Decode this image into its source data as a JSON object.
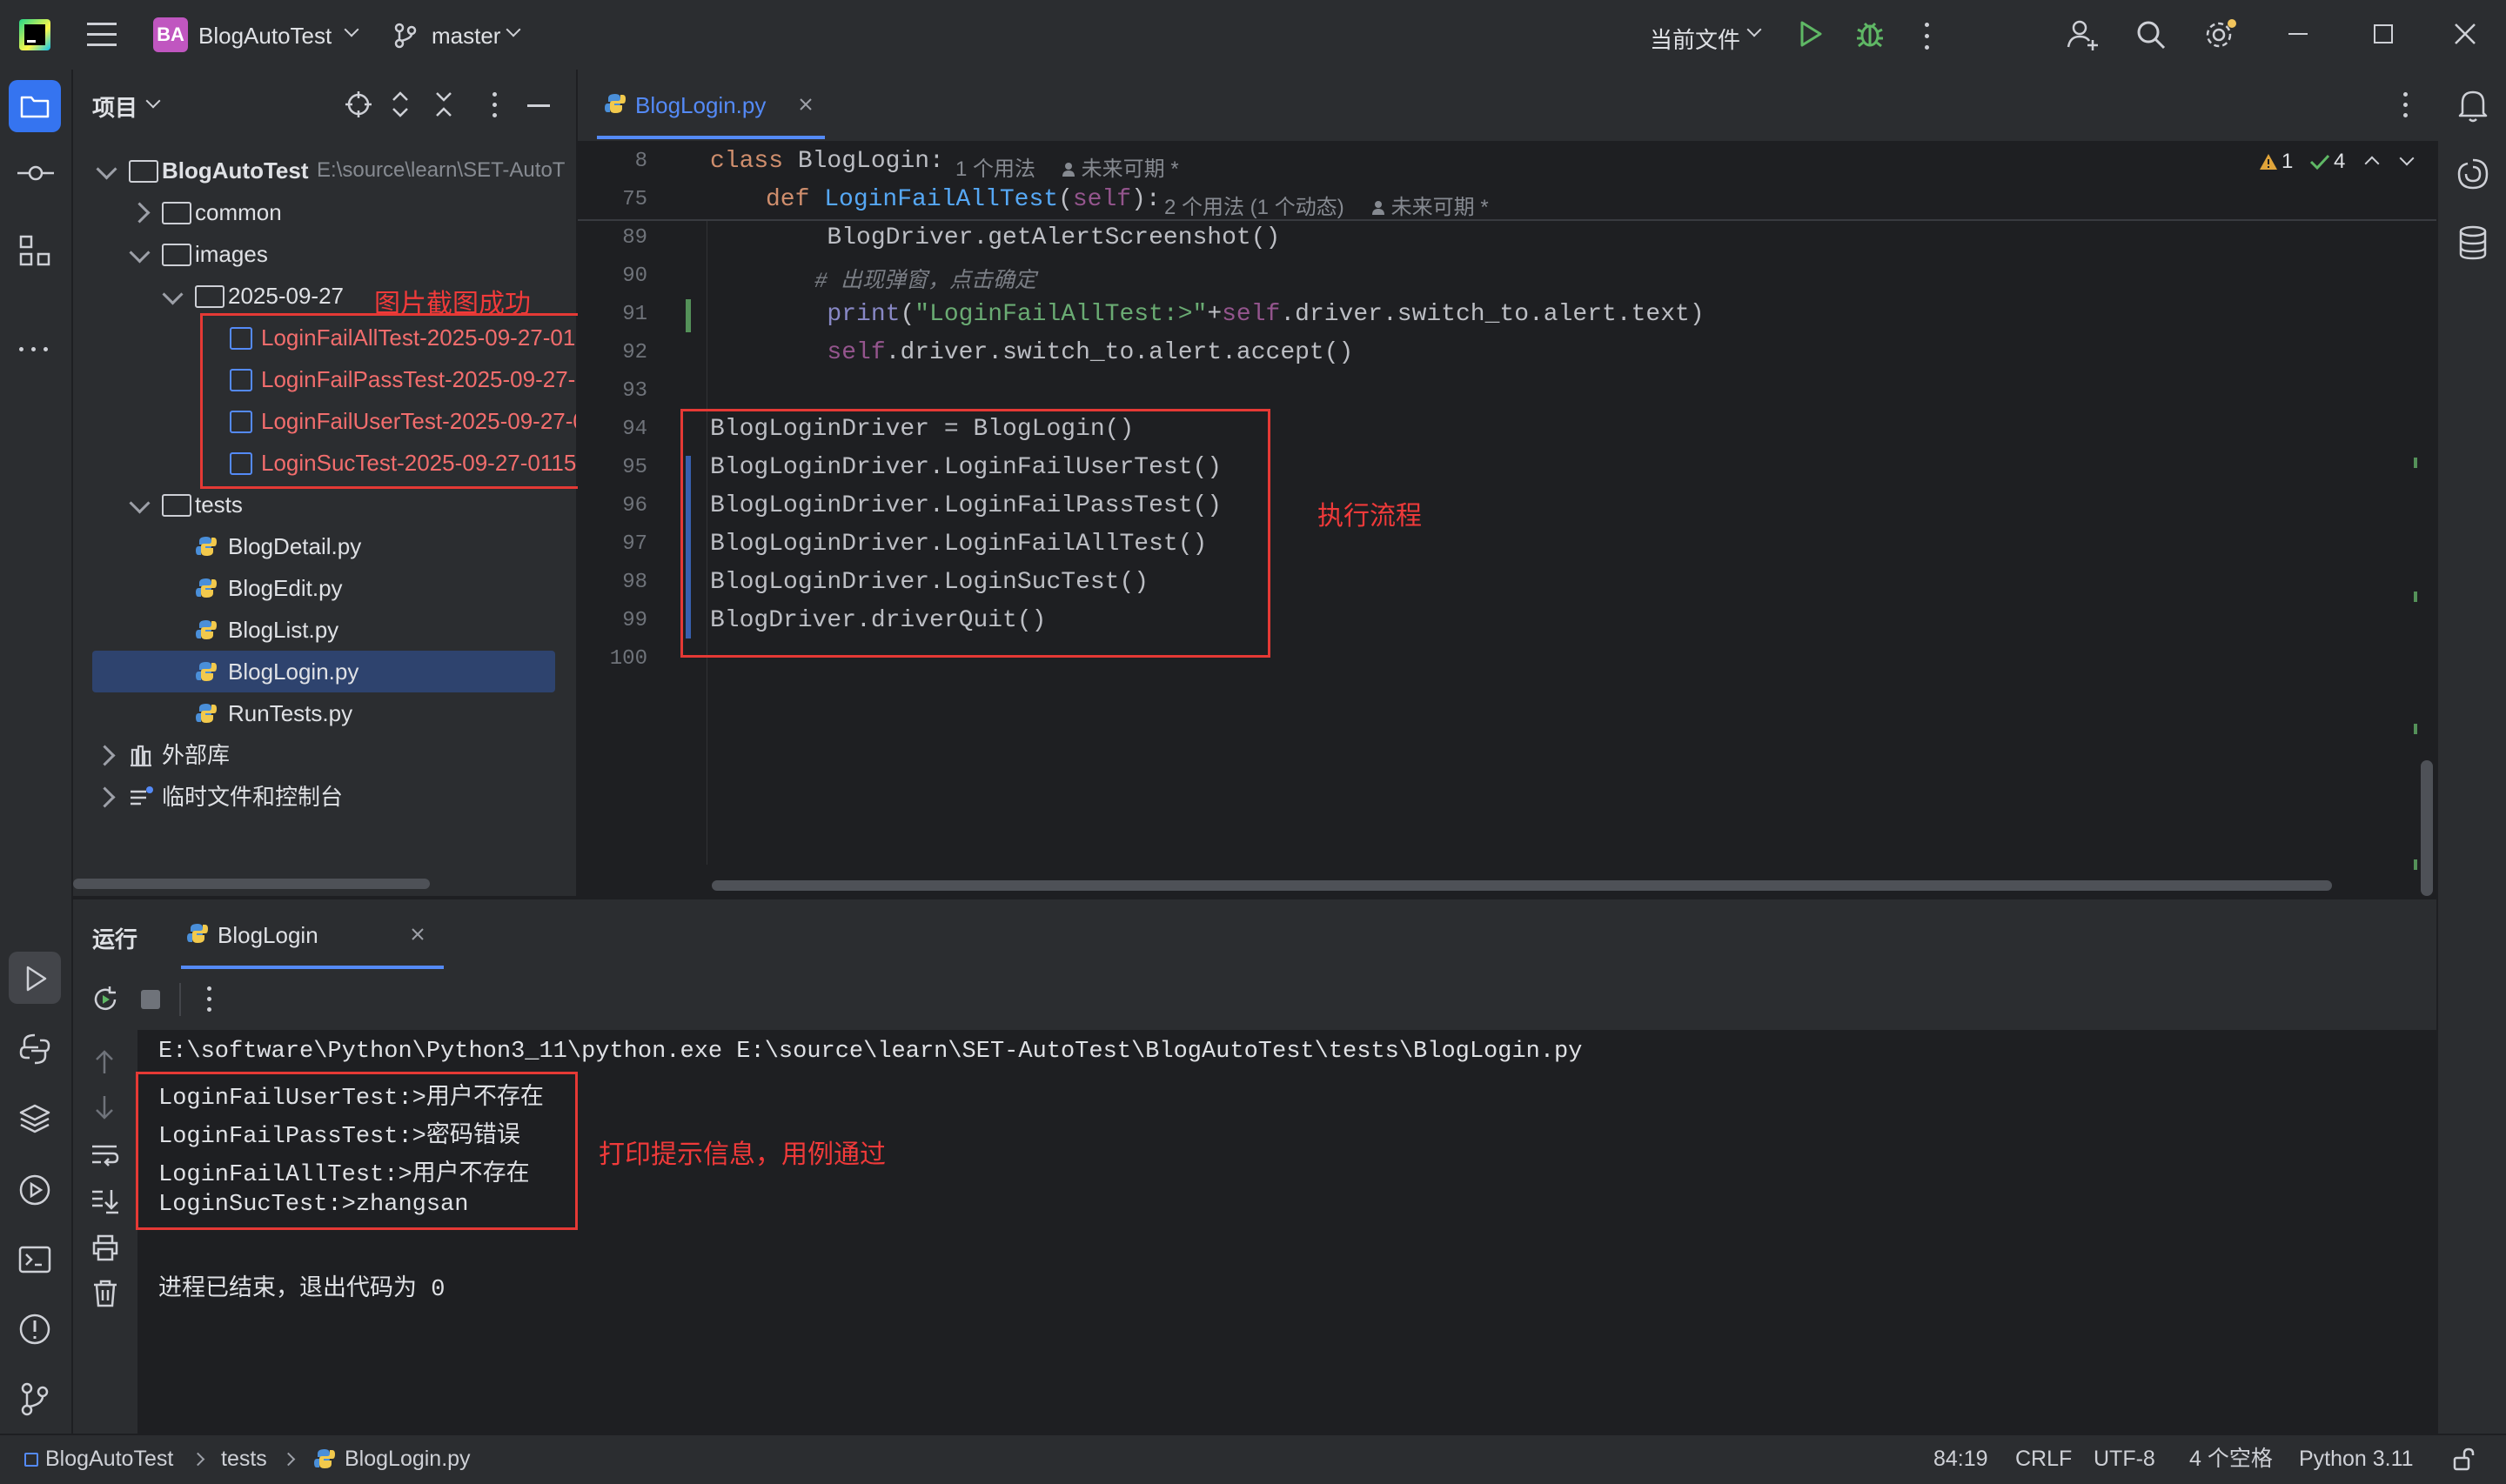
{
  "titlebar": {
    "project_badge": "BA",
    "project_name": "BlogAutoTest",
    "branch": "master",
    "run_config": "当前文件"
  },
  "project_panel": {
    "title": "项目",
    "root": "BlogAutoTest",
    "root_path": "E:\\source\\learn\\SET-AutoT",
    "items": [
      {
        "label": "common"
      },
      {
        "label": "images"
      },
      {
        "label": "2025-09-27"
      },
      {
        "label": "LoginFailAllTest-2025-09-27-01"
      },
      {
        "label": "LoginFailPassTest-2025-09-27-0"
      },
      {
        "label": "LoginFailUserTest-2025-09-27-0"
      },
      {
        "label": "LoginSucTest-2025-09-27-0115"
      },
      {
        "label": "tests"
      },
      {
        "label": "BlogDetail.py"
      },
      {
        "label": "BlogEdit.py"
      },
      {
        "label": "BlogList.py"
      },
      {
        "label": "BlogLogin.py"
      },
      {
        "label": "RunTests.py"
      },
      {
        "label": "外部库"
      },
      {
        "label": "临时文件和控制台"
      }
    ],
    "annotation": "图片截图成功"
  },
  "editor": {
    "tab_label": "BlogLogin.py",
    "inspection": {
      "warnings": "1",
      "ok": "4"
    },
    "sticky": [
      {
        "line": "8",
        "kw": "class ",
        "name": "BlogLogin:",
        "hint": "1 个用法",
        "hint2": "未来可期 *"
      },
      {
        "line": "75",
        "kw": "def ",
        "name": "LoginFailAllTest",
        "args_open": "(",
        "self": "self",
        "args_close": "):",
        "hint": "2 个用法 (1 个动态)",
        "hint2": "未来可期 *"
      }
    ],
    "lines": [
      {
        "n": "89",
        "text": "        BlogDriver.getAlertScreenshot()"
      },
      {
        "n": "90",
        "comment": "        # 出现弹窗，点击确定"
      },
      {
        "n": "91",
        "p1": "        ",
        "fn": "print",
        "p2": "(",
        "str": "\"LoginFailAllTest:>\"",
        "p3": "+",
        "self": "self",
        "p4": ".driver.switch_to.alert.text)"
      },
      {
        "n": "92",
        "p1": "        ",
        "self": "self",
        "p4": ".driver.switch_to.alert.accept()"
      },
      {
        "n": "93",
        "text": ""
      },
      {
        "n": "94",
        "text": "BlogLoginDriver = BlogLogin()"
      },
      {
        "n": "95",
        "text": "BlogLoginDriver.LoginFailUserTest()"
      },
      {
        "n": "96",
        "text": "BlogLoginDriver.LoginFailPassTest()"
      },
      {
        "n": "97",
        "text": "BlogLoginDriver.LoginFailAllTest()"
      },
      {
        "n": "98",
        "text": "BlogLoginDriver.LoginSucTest()"
      },
      {
        "n": "99",
        "text": "BlogDriver.driverQuit()"
      },
      {
        "n": "100",
        "text": ""
      }
    ],
    "annotation": "执行流程"
  },
  "run_panel": {
    "title": "运行",
    "tab": "BlogLogin",
    "output": [
      "E:\\software\\Python\\Python3_11\\python.exe E:\\source\\learn\\SET-AutoTest\\BlogAutoTest\\tests\\BlogLogin.py",
      "LoginFailUserTest:>用户不存在",
      "LoginFailPassTest:>密码错误",
      "LoginFailAllTest:>用户不存在",
      "LoginSucTest:>zhangsan",
      "",
      "进程已结束，退出代码为 0"
    ],
    "annotation": "打印提示信息，用例通过"
  },
  "statusbar": {
    "crumbs": [
      "BlogAutoTest",
      "tests",
      "BlogLogin.py"
    ],
    "position": "84:19",
    "line_sep": "CRLF",
    "encoding": "UTF-8",
    "indent": "4 个空格",
    "interpreter": "Python 3.11"
  },
  "colors": {
    "accent": "#548af7",
    "annotation_red": "#e53935",
    "keyword": "#cf8e6d",
    "function": "#56a8f5",
    "string": "#6aab73"
  }
}
